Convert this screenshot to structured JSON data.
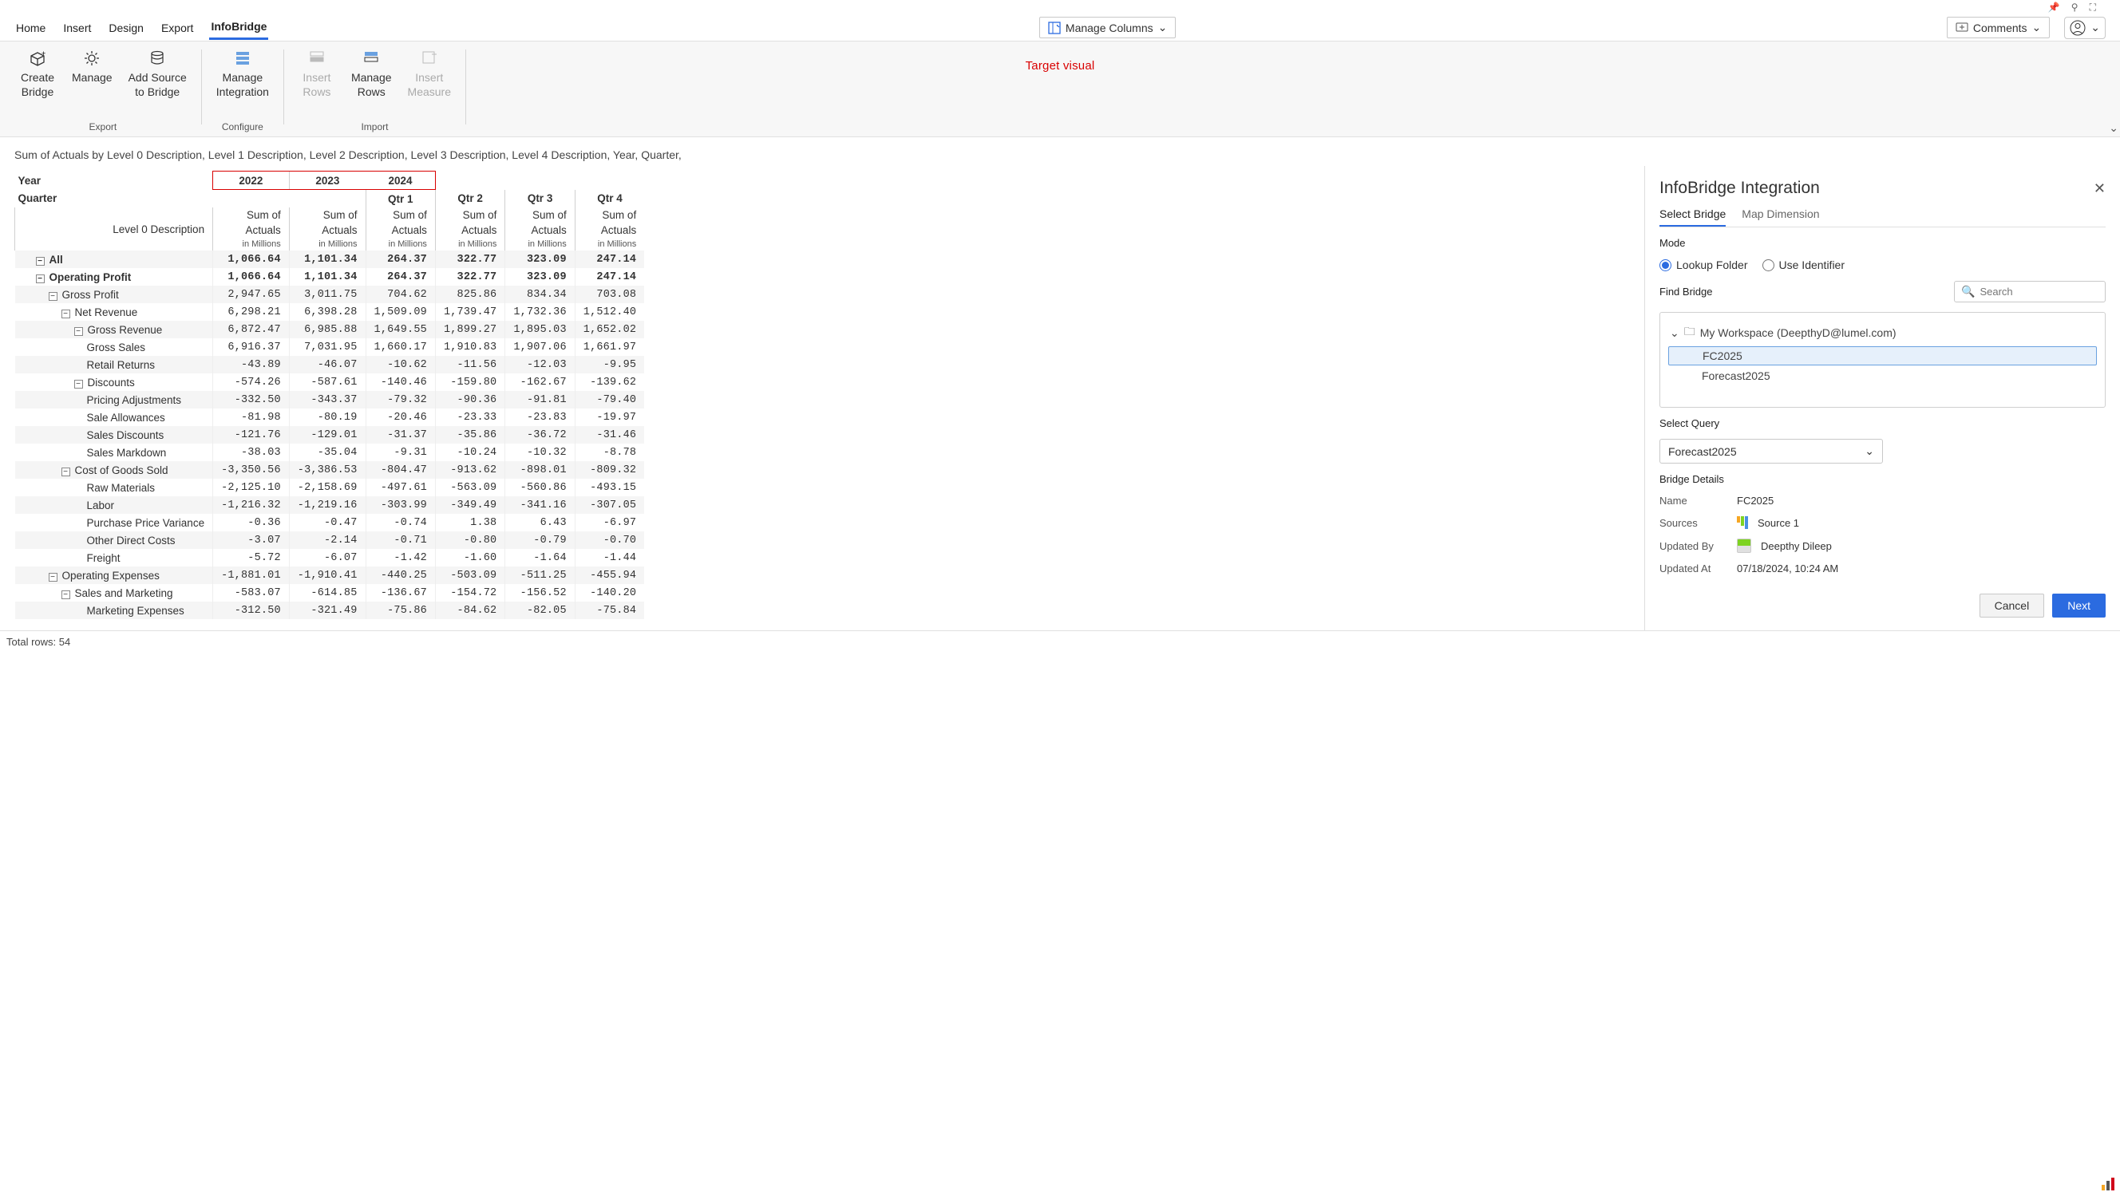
{
  "tabs": {
    "home": "Home",
    "insert": "Insert",
    "design": "Design",
    "export": "Export",
    "infobridge": "InfoBridge"
  },
  "toolbar": {
    "manage_columns": "Manage Columns",
    "comments": "Comments"
  },
  "ribbon": {
    "export": {
      "create_bridge_l1": "Create",
      "create_bridge_l2": "Bridge",
      "manage": "Manage",
      "add_src_l1": "Add Source",
      "add_src_l2": "to Bridge",
      "group": "Export"
    },
    "configure": {
      "manage_int_l1": "Manage",
      "manage_int_l2": "Integration",
      "group": "Configure"
    },
    "import": {
      "insert_rows_l1": "Insert",
      "insert_rows_l2": "Rows",
      "manage_rows_l1": "Manage",
      "manage_rows_l2": "Rows",
      "insert_measure_l1": "Insert",
      "insert_measure_l2": "Measure",
      "group": "Import"
    },
    "target_visual": "Target visual"
  },
  "title": "Sum of Actuals by Level 0 Description, Level 1 Description, Level 2 Description, Level 3 Description, Level 4 Description, Year, Quarter,",
  "grid": {
    "year_label": "Year",
    "quarter_label": "Quarter",
    "level0_label": "Level 0 Description",
    "years": [
      "2022",
      "2023",
      "2024"
    ],
    "quarters": [
      "Qtr 1",
      "Qtr 2",
      "Qtr 3",
      "Qtr 4"
    ],
    "colhead_main": "Sum of",
    "colhead_main2": "Actuals",
    "colhead_sub": "in Millions",
    "rows": [
      {
        "label": "All",
        "indent": 0,
        "bold": true,
        "exp": true,
        "v": [
          "1,066.64",
          "1,101.34",
          "264.37",
          "322.77",
          "323.09",
          "247.14"
        ]
      },
      {
        "label": "Operating Profit",
        "indent": 0,
        "bold": true,
        "exp": true,
        "v": [
          "1,066.64",
          "1,101.34",
          "264.37",
          "322.77",
          "323.09",
          "247.14"
        ]
      },
      {
        "label": "Gross Profit",
        "indent": 1,
        "exp": true,
        "v": [
          "2,947.65",
          "3,011.75",
          "704.62",
          "825.86",
          "834.34",
          "703.08"
        ]
      },
      {
        "label": "Net Revenue",
        "indent": 2,
        "exp": true,
        "v": [
          "6,298.21",
          "6,398.28",
          "1,509.09",
          "1,739.47",
          "1,732.36",
          "1,512.40"
        ]
      },
      {
        "label": "Gross Revenue",
        "indent": 3,
        "exp": true,
        "v": [
          "6,872.47",
          "6,985.88",
          "1,649.55",
          "1,899.27",
          "1,895.03",
          "1,652.02"
        ]
      },
      {
        "label": "Gross Sales",
        "indent": 4,
        "v": [
          "6,916.37",
          "7,031.95",
          "1,660.17",
          "1,910.83",
          "1,907.06",
          "1,661.97"
        ]
      },
      {
        "label": "Retail Returns",
        "indent": 4,
        "v": [
          "-43.89",
          "-46.07",
          "-10.62",
          "-11.56",
          "-12.03",
          "-9.95"
        ]
      },
      {
        "label": "Discounts",
        "indent": 3,
        "exp": true,
        "v": [
          "-574.26",
          "-587.61",
          "-140.46",
          "-159.80",
          "-162.67",
          "-139.62"
        ]
      },
      {
        "label": "Pricing Adjustments",
        "indent": 4,
        "v": [
          "-332.50",
          "-343.37",
          "-79.32",
          "-90.36",
          "-91.81",
          "-79.40"
        ]
      },
      {
        "label": "Sale Allowances",
        "indent": 4,
        "v": [
          "-81.98",
          "-80.19",
          "-20.46",
          "-23.33",
          "-23.83",
          "-19.97"
        ]
      },
      {
        "label": "Sales Discounts",
        "indent": 4,
        "v": [
          "-121.76",
          "-129.01",
          "-31.37",
          "-35.86",
          "-36.72",
          "-31.46"
        ]
      },
      {
        "label": "Sales Markdown",
        "indent": 4,
        "v": [
          "-38.03",
          "-35.04",
          "-9.31",
          "-10.24",
          "-10.32",
          "-8.78"
        ]
      },
      {
        "label": "Cost of Goods Sold",
        "indent": 2,
        "exp": true,
        "v": [
          "-3,350.56",
          "-3,386.53",
          "-804.47",
          "-913.62",
          "-898.01",
          "-809.32"
        ]
      },
      {
        "label": "Raw Materials",
        "indent": 4,
        "v": [
          "-2,125.10",
          "-2,158.69",
          "-497.61",
          "-563.09",
          "-560.86",
          "-493.15"
        ]
      },
      {
        "label": "Labor",
        "indent": 4,
        "v": [
          "-1,216.32",
          "-1,219.16",
          "-303.99",
          "-349.49",
          "-341.16",
          "-307.05"
        ]
      },
      {
        "label": "Purchase Price Variance",
        "indent": 4,
        "v": [
          "-0.36",
          "-0.47",
          "-0.74",
          "1.38",
          "6.43",
          "-6.97"
        ]
      },
      {
        "label": "Other Direct Costs",
        "indent": 4,
        "v": [
          "-3.07",
          "-2.14",
          "-0.71",
          "-0.80",
          "-0.79",
          "-0.70"
        ]
      },
      {
        "label": "Freight",
        "indent": 4,
        "v": [
          "-5.72",
          "-6.07",
          "-1.42",
          "-1.60",
          "-1.64",
          "-1.44"
        ]
      },
      {
        "label": "Operating Expenses",
        "indent": 1,
        "exp": true,
        "v": [
          "-1,881.01",
          "-1,910.41",
          "-440.25",
          "-503.09",
          "-511.25",
          "-455.94"
        ]
      },
      {
        "label": "Sales and Marketing",
        "indent": 2,
        "exp": true,
        "v": [
          "-583.07",
          "-614.85",
          "-136.67",
          "-154.72",
          "-156.52",
          "-140.20"
        ]
      },
      {
        "label": "Marketing Expenses",
        "indent": 4,
        "v": [
          "-312.50",
          "-321.49",
          "-75.86",
          "-84.62",
          "-82.05",
          "-75.84"
        ]
      }
    ]
  },
  "status": {
    "total_rows": "Total rows: 54"
  },
  "panel": {
    "title": "InfoBridge Integration",
    "tabs": {
      "select": "Select Bridge",
      "map": "Map Dimension"
    },
    "mode_label": "Mode",
    "mode_lookup": "Lookup Folder",
    "mode_identifier": "Use Identifier",
    "find_label": "Find Bridge",
    "search_placeholder": "Search",
    "workspace": "My Workspace (DeepthyD@lumel.com)",
    "tree_item1": "FC2025",
    "tree_item2": "Forecast2025",
    "select_query_label": "Select Query",
    "select_query_value": "Forecast2025",
    "details_label": "Bridge Details",
    "details": {
      "name_k": "Name",
      "name_v": "FC2025",
      "sources_k": "Sources",
      "sources_v": "Source 1",
      "updated_by_k": "Updated By",
      "updated_by_v": "Deepthy Dileep",
      "updated_at_k": "Updated At",
      "updated_at_v": "07/18/2024, 10:24 AM"
    },
    "cancel": "Cancel",
    "next": "Next"
  }
}
